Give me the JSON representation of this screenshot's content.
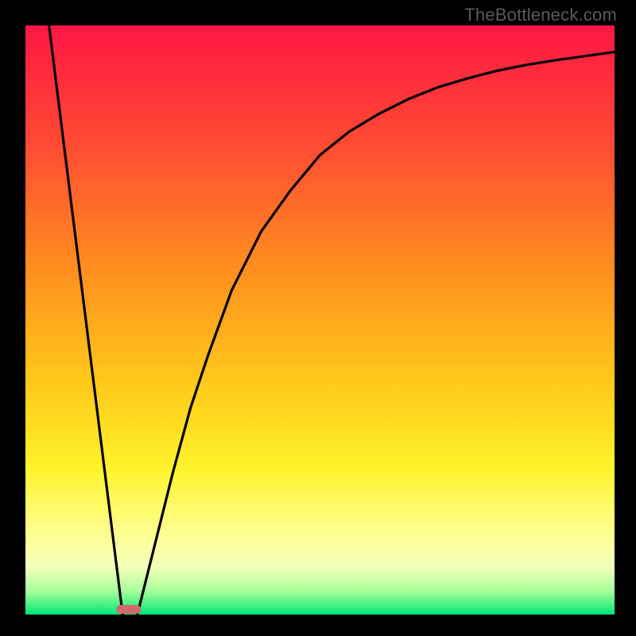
{
  "watermark": "TheBottleneck.com",
  "chart_data": {
    "type": "line",
    "title": "",
    "xlabel": "",
    "ylabel": "",
    "xlim": [
      0,
      100
    ],
    "ylim": [
      0,
      100
    ],
    "gradient_stops": [
      {
        "offset": 0,
        "color": "#ff1744"
      },
      {
        "offset": 20,
        "color": "#ff4a33"
      },
      {
        "offset": 40,
        "color": "#ff8a1f"
      },
      {
        "offset": 60,
        "color": "#ffc71a"
      },
      {
        "offset": 75,
        "color": "#fff22a"
      },
      {
        "offset": 82,
        "color": "#fffb6a"
      },
      {
        "offset": 88,
        "color": "#fdffa0"
      },
      {
        "offset": 92,
        "color": "#f0ffb8"
      },
      {
        "offset": 96,
        "color": "#a8ff9a"
      },
      {
        "offset": 100,
        "color": "#00e676"
      }
    ],
    "series": [
      {
        "name": "left-leg",
        "x": [
          4,
          16.5
        ],
        "y": [
          100,
          0
        ]
      },
      {
        "name": "right-curve",
        "x": [
          19,
          22,
          25,
          28,
          31,
          35,
          40,
          45,
          50,
          55,
          60,
          65,
          70,
          75,
          80,
          85,
          90,
          95,
          100
        ],
        "y": [
          0,
          12,
          24,
          35,
          44,
          55,
          65,
          72,
          78,
          82,
          85,
          87.5,
          89.5,
          91,
          92.3,
          93.3,
          94.1,
          94.8,
          95.5
        ]
      }
    ],
    "marker": {
      "name": "bottleneck-pill",
      "x_center": 17.5,
      "width": 4.2,
      "color": "#d2696e"
    }
  }
}
